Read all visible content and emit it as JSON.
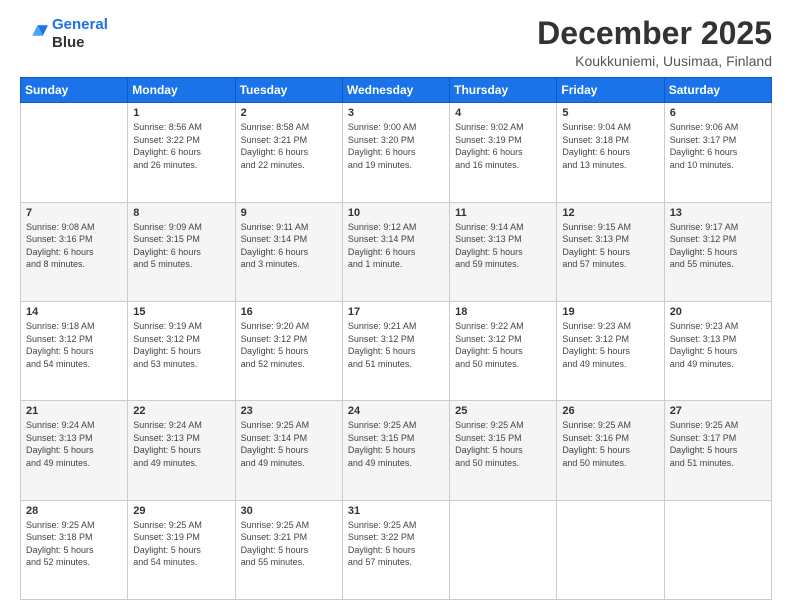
{
  "header": {
    "logo_line1": "General",
    "logo_line2": "Blue",
    "title": "December 2025",
    "subtitle": "Koukkuniemi, Uusimaa, Finland"
  },
  "weekdays": [
    "Sunday",
    "Monday",
    "Tuesday",
    "Wednesday",
    "Thursday",
    "Friday",
    "Saturday"
  ],
  "weeks": [
    [
      {
        "day": "",
        "info": ""
      },
      {
        "day": "1",
        "info": "Sunrise: 8:56 AM\nSunset: 3:22 PM\nDaylight: 6 hours\nand 26 minutes."
      },
      {
        "day": "2",
        "info": "Sunrise: 8:58 AM\nSunset: 3:21 PM\nDaylight: 6 hours\nand 22 minutes."
      },
      {
        "day": "3",
        "info": "Sunrise: 9:00 AM\nSunset: 3:20 PM\nDaylight: 6 hours\nand 19 minutes."
      },
      {
        "day": "4",
        "info": "Sunrise: 9:02 AM\nSunset: 3:19 PM\nDaylight: 6 hours\nand 16 minutes."
      },
      {
        "day": "5",
        "info": "Sunrise: 9:04 AM\nSunset: 3:18 PM\nDaylight: 6 hours\nand 13 minutes."
      },
      {
        "day": "6",
        "info": "Sunrise: 9:06 AM\nSunset: 3:17 PM\nDaylight: 6 hours\nand 10 minutes."
      }
    ],
    [
      {
        "day": "7",
        "info": "Sunrise: 9:08 AM\nSunset: 3:16 PM\nDaylight: 6 hours\nand 8 minutes."
      },
      {
        "day": "8",
        "info": "Sunrise: 9:09 AM\nSunset: 3:15 PM\nDaylight: 6 hours\nand 5 minutes."
      },
      {
        "day": "9",
        "info": "Sunrise: 9:11 AM\nSunset: 3:14 PM\nDaylight: 6 hours\nand 3 minutes."
      },
      {
        "day": "10",
        "info": "Sunrise: 9:12 AM\nSunset: 3:14 PM\nDaylight: 6 hours\nand 1 minute."
      },
      {
        "day": "11",
        "info": "Sunrise: 9:14 AM\nSunset: 3:13 PM\nDaylight: 5 hours\nand 59 minutes."
      },
      {
        "day": "12",
        "info": "Sunrise: 9:15 AM\nSunset: 3:13 PM\nDaylight: 5 hours\nand 57 minutes."
      },
      {
        "day": "13",
        "info": "Sunrise: 9:17 AM\nSunset: 3:12 PM\nDaylight: 5 hours\nand 55 minutes."
      }
    ],
    [
      {
        "day": "14",
        "info": "Sunrise: 9:18 AM\nSunset: 3:12 PM\nDaylight: 5 hours\nand 54 minutes."
      },
      {
        "day": "15",
        "info": "Sunrise: 9:19 AM\nSunset: 3:12 PM\nDaylight: 5 hours\nand 53 minutes."
      },
      {
        "day": "16",
        "info": "Sunrise: 9:20 AM\nSunset: 3:12 PM\nDaylight: 5 hours\nand 52 minutes."
      },
      {
        "day": "17",
        "info": "Sunrise: 9:21 AM\nSunset: 3:12 PM\nDaylight: 5 hours\nand 51 minutes."
      },
      {
        "day": "18",
        "info": "Sunrise: 9:22 AM\nSunset: 3:12 PM\nDaylight: 5 hours\nand 50 minutes."
      },
      {
        "day": "19",
        "info": "Sunrise: 9:23 AM\nSunset: 3:12 PM\nDaylight: 5 hours\nand 49 minutes."
      },
      {
        "day": "20",
        "info": "Sunrise: 9:23 AM\nSunset: 3:13 PM\nDaylight: 5 hours\nand 49 minutes."
      }
    ],
    [
      {
        "day": "21",
        "info": "Sunrise: 9:24 AM\nSunset: 3:13 PM\nDaylight: 5 hours\nand 49 minutes."
      },
      {
        "day": "22",
        "info": "Sunrise: 9:24 AM\nSunset: 3:13 PM\nDaylight: 5 hours\nand 49 minutes."
      },
      {
        "day": "23",
        "info": "Sunrise: 9:25 AM\nSunset: 3:14 PM\nDaylight: 5 hours\nand 49 minutes."
      },
      {
        "day": "24",
        "info": "Sunrise: 9:25 AM\nSunset: 3:15 PM\nDaylight: 5 hours\nand 49 minutes."
      },
      {
        "day": "25",
        "info": "Sunrise: 9:25 AM\nSunset: 3:15 PM\nDaylight: 5 hours\nand 50 minutes."
      },
      {
        "day": "26",
        "info": "Sunrise: 9:25 AM\nSunset: 3:16 PM\nDaylight: 5 hours\nand 50 minutes."
      },
      {
        "day": "27",
        "info": "Sunrise: 9:25 AM\nSunset: 3:17 PM\nDaylight: 5 hours\nand 51 minutes."
      }
    ],
    [
      {
        "day": "28",
        "info": "Sunrise: 9:25 AM\nSunset: 3:18 PM\nDaylight: 5 hours\nand 52 minutes."
      },
      {
        "day": "29",
        "info": "Sunrise: 9:25 AM\nSunset: 3:19 PM\nDaylight: 5 hours\nand 54 minutes."
      },
      {
        "day": "30",
        "info": "Sunrise: 9:25 AM\nSunset: 3:21 PM\nDaylight: 5 hours\nand 55 minutes."
      },
      {
        "day": "31",
        "info": "Sunrise: 9:25 AM\nSunset: 3:22 PM\nDaylight: 5 hours\nand 57 minutes."
      },
      {
        "day": "",
        "info": ""
      },
      {
        "day": "",
        "info": ""
      },
      {
        "day": "",
        "info": ""
      }
    ]
  ]
}
